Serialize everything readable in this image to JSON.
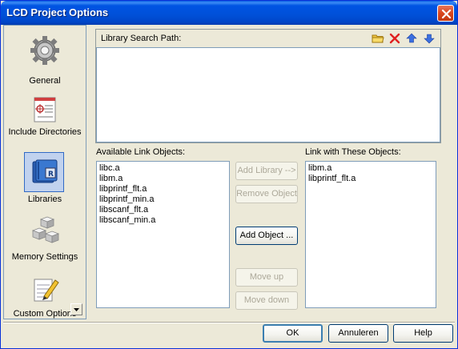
{
  "window": {
    "title": "LCD Project Options"
  },
  "sidebar": {
    "items": [
      {
        "label": "General",
        "icon": "gear-icon"
      },
      {
        "label": "Include Directories",
        "icon": "include-directories-icon"
      },
      {
        "label": "Libraries",
        "icon": "libraries-icon",
        "selected": true
      },
      {
        "label": "Memory Settings",
        "icon": "memory-cubes-icon"
      },
      {
        "label": "Custom Options",
        "icon": "notepad-pencil-icon"
      }
    ]
  },
  "library_search": {
    "label": "Library Search Path:",
    "toolbar": {
      "open": "folder-icon",
      "delete": "delete-icon",
      "up": "arrow-up-icon",
      "down": "arrow-down-icon"
    },
    "paths": []
  },
  "available": {
    "label": "Available Link Objects:",
    "items": [
      "libc.a",
      "libm.a",
      "libprintf_flt.a",
      "libprintf_min.a",
      "libscanf_flt.a",
      "libscanf_min.a"
    ]
  },
  "linked": {
    "label": "Link with These Objects:",
    "items": [
      "libm.a",
      "libprintf_flt.a"
    ]
  },
  "actions": {
    "add_library": "Add Library -->",
    "remove_object": "Remove Object",
    "add_object": "Add Object ...",
    "move_up": "Move up",
    "move_down": "Move down"
  },
  "footer": {
    "ok": "OK",
    "cancel": "Annuleren",
    "help": "Help"
  }
}
